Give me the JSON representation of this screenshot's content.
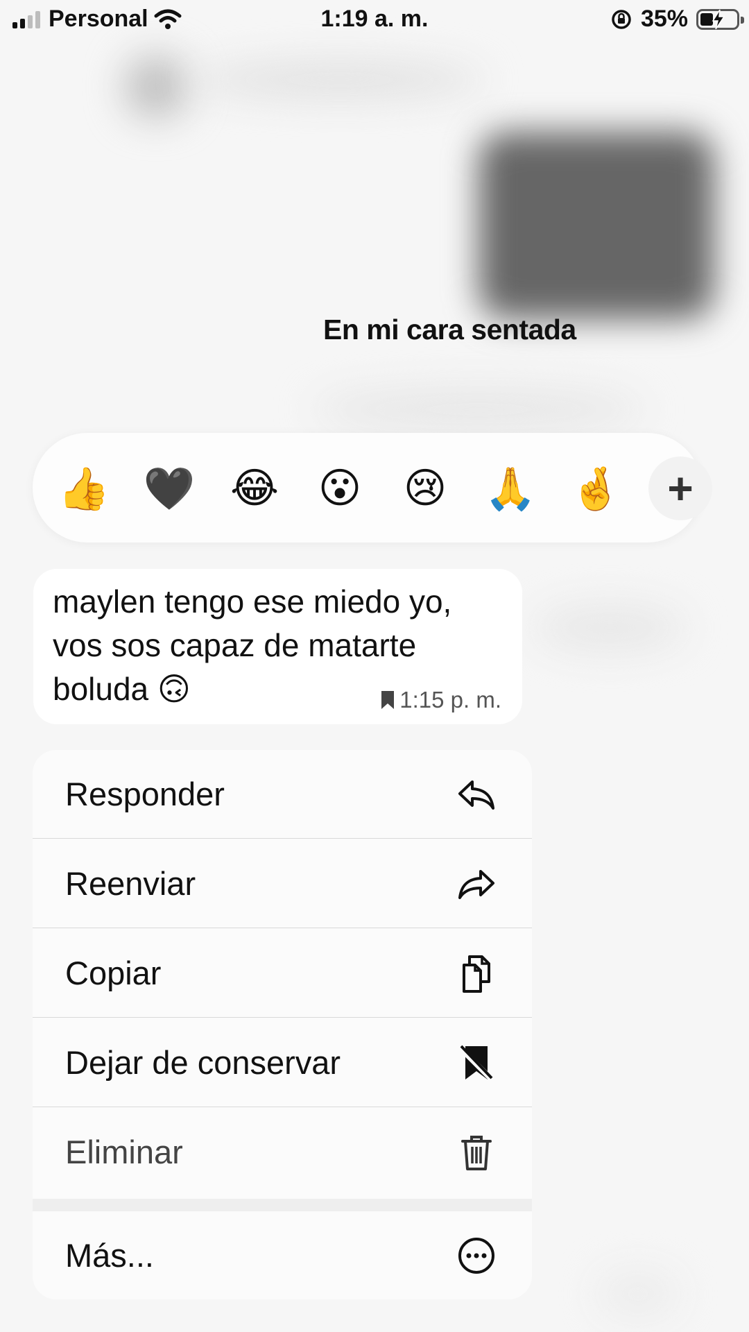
{
  "status_bar": {
    "carrier": "Personal",
    "time": "1:19 a. m.",
    "battery": "35%"
  },
  "chat": {
    "caption": "En mi cara sentada"
  },
  "reactions": {
    "items": [
      "👍",
      "🖤",
      "😂",
      "😮",
      "😢",
      "🙏",
      "🤞"
    ],
    "more_label": "+"
  },
  "message": {
    "text": "maylen tengo ese miedo yo, vos sos capaz de matarte boluda 🙃",
    "time": "1:15 p. m."
  },
  "menu": {
    "items": [
      {
        "label": "Responder",
        "icon": "reply-icon"
      },
      {
        "label": "Reenviar",
        "icon": "forward-icon"
      },
      {
        "label": "Copiar",
        "icon": "copy-icon"
      },
      {
        "label": "Dejar de conservar",
        "icon": "unsave-icon"
      },
      {
        "label": "Eliminar",
        "icon": "trash-icon"
      },
      {
        "label": "Más...",
        "icon": "more-icon"
      }
    ]
  }
}
